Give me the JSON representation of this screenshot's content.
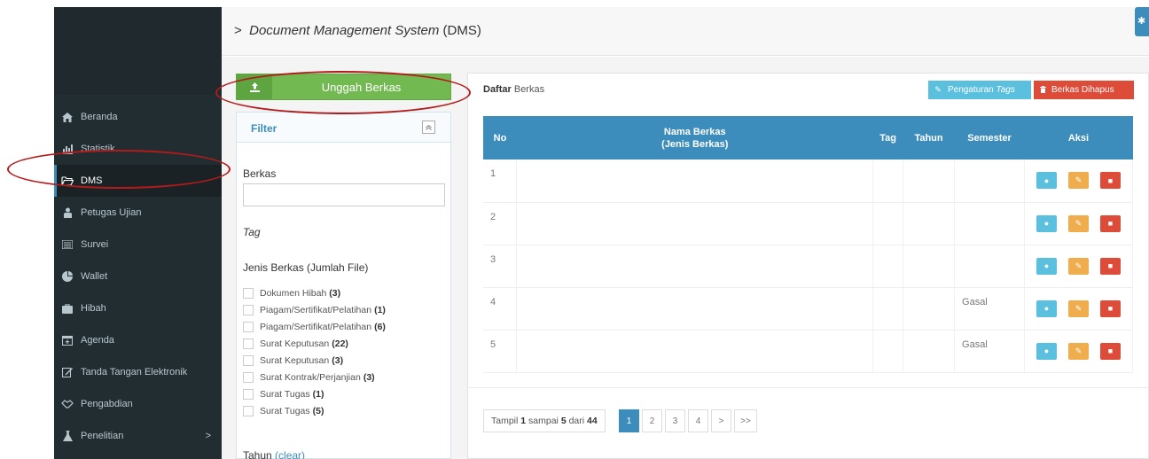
{
  "header": {
    "title_italic": "Document Management System",
    "title_suffix": " (DMS)",
    "breadcrumb_chevron": ">",
    "gear_icon": "gear-icon"
  },
  "sidebar": {
    "items": [
      {
        "label": "Beranda",
        "icon": "home-icon"
      },
      {
        "label": "Statistik",
        "icon": "bar-chart-icon"
      },
      {
        "label": "DMS",
        "icon": "folder-open-icon"
      },
      {
        "label": "Petugas Ujian",
        "icon": "person-icon"
      },
      {
        "label": "Survei",
        "icon": "list-icon"
      },
      {
        "label": "Wallet",
        "icon": "pie-chart-icon"
      },
      {
        "label": "Hibah",
        "icon": "briefcase-icon"
      },
      {
        "label": "Agenda",
        "icon": "calendar-icon"
      },
      {
        "label": "Tanda Tangan Elektronik",
        "icon": "edit-icon"
      },
      {
        "label": "Pengabdian",
        "icon": "handshake-icon"
      },
      {
        "label": "Penelitian",
        "icon": "flask-icon",
        "chevron": ">"
      }
    ],
    "active": "DMS"
  },
  "upload": {
    "label": "Unggah Berkas"
  },
  "filter": {
    "title": "Filter",
    "collapse": "^",
    "berkas_label": "Berkas",
    "tag_label": "Tag",
    "jenis_label": "Jenis Berkas (Jumlah File)",
    "jenis_items": [
      {
        "name": "Dokumen Hibah",
        "count": "(3)"
      },
      {
        "name": "Piagam/Sertifikat/Pelatihan",
        "count": "(1)"
      },
      {
        "name": "Piagam/Sertifikat/Pelatihan",
        "count": "(6)"
      },
      {
        "name": "Surat Keputusan",
        "count": "(22)"
      },
      {
        "name": "Surat Keputusan",
        "count": "(3)"
      },
      {
        "name": "Surat Kontrak/Perjanjian",
        "count": "(3)"
      },
      {
        "name": "Surat Tugas",
        "count": "(1)"
      },
      {
        "name": "Surat Tugas",
        "count": "(5)"
      }
    ],
    "tahun_label": "Tahun",
    "clear_label": "(clear)"
  },
  "main": {
    "daftar_bold": "Daftar",
    "daftar_rest": " Berkas",
    "tags_button": "Pengaturan",
    "tags_button_italic": "Tags",
    "deleted_button": "Berkas Dihapus",
    "columns": {
      "no": "No",
      "nama": "Nama Berkas",
      "jenis": "(Jenis Berkas)",
      "tag": "Tag",
      "tahun": "Tahun",
      "semester": "Semester",
      "aksi": "Aksi"
    },
    "rows": [
      {
        "no": "1",
        "nama": "",
        "tag": "",
        "tahun": "",
        "semester": ""
      },
      {
        "no": "2",
        "nama": "",
        "tag": "",
        "tahun": "",
        "semester": ""
      },
      {
        "no": "3",
        "nama": "",
        "tag": "",
        "tahun": "",
        "semester": ""
      },
      {
        "no": "4",
        "nama": "",
        "tag": "",
        "tahun": "",
        "semester": "Gasal"
      },
      {
        "no": "5",
        "nama": "",
        "tag": "",
        "tahun": "",
        "semester": "Gasal"
      }
    ]
  },
  "pagination": {
    "info_prefix": "Tampil ",
    "from": "1",
    "mid": " sampai ",
    "to": "5",
    "of_text": " dari ",
    "total": "44",
    "pages": [
      "1",
      "2",
      "3",
      "4",
      ">",
      ">>"
    ],
    "active_page": "1"
  },
  "colors": {
    "sidebar_bg": "#222d32",
    "primary": "#3c8dbc",
    "success": "#72b952",
    "danger": "#dd4b39",
    "warning": "#f0ad4e",
    "info": "#5bc0de",
    "annotation": "#b31b1b"
  }
}
